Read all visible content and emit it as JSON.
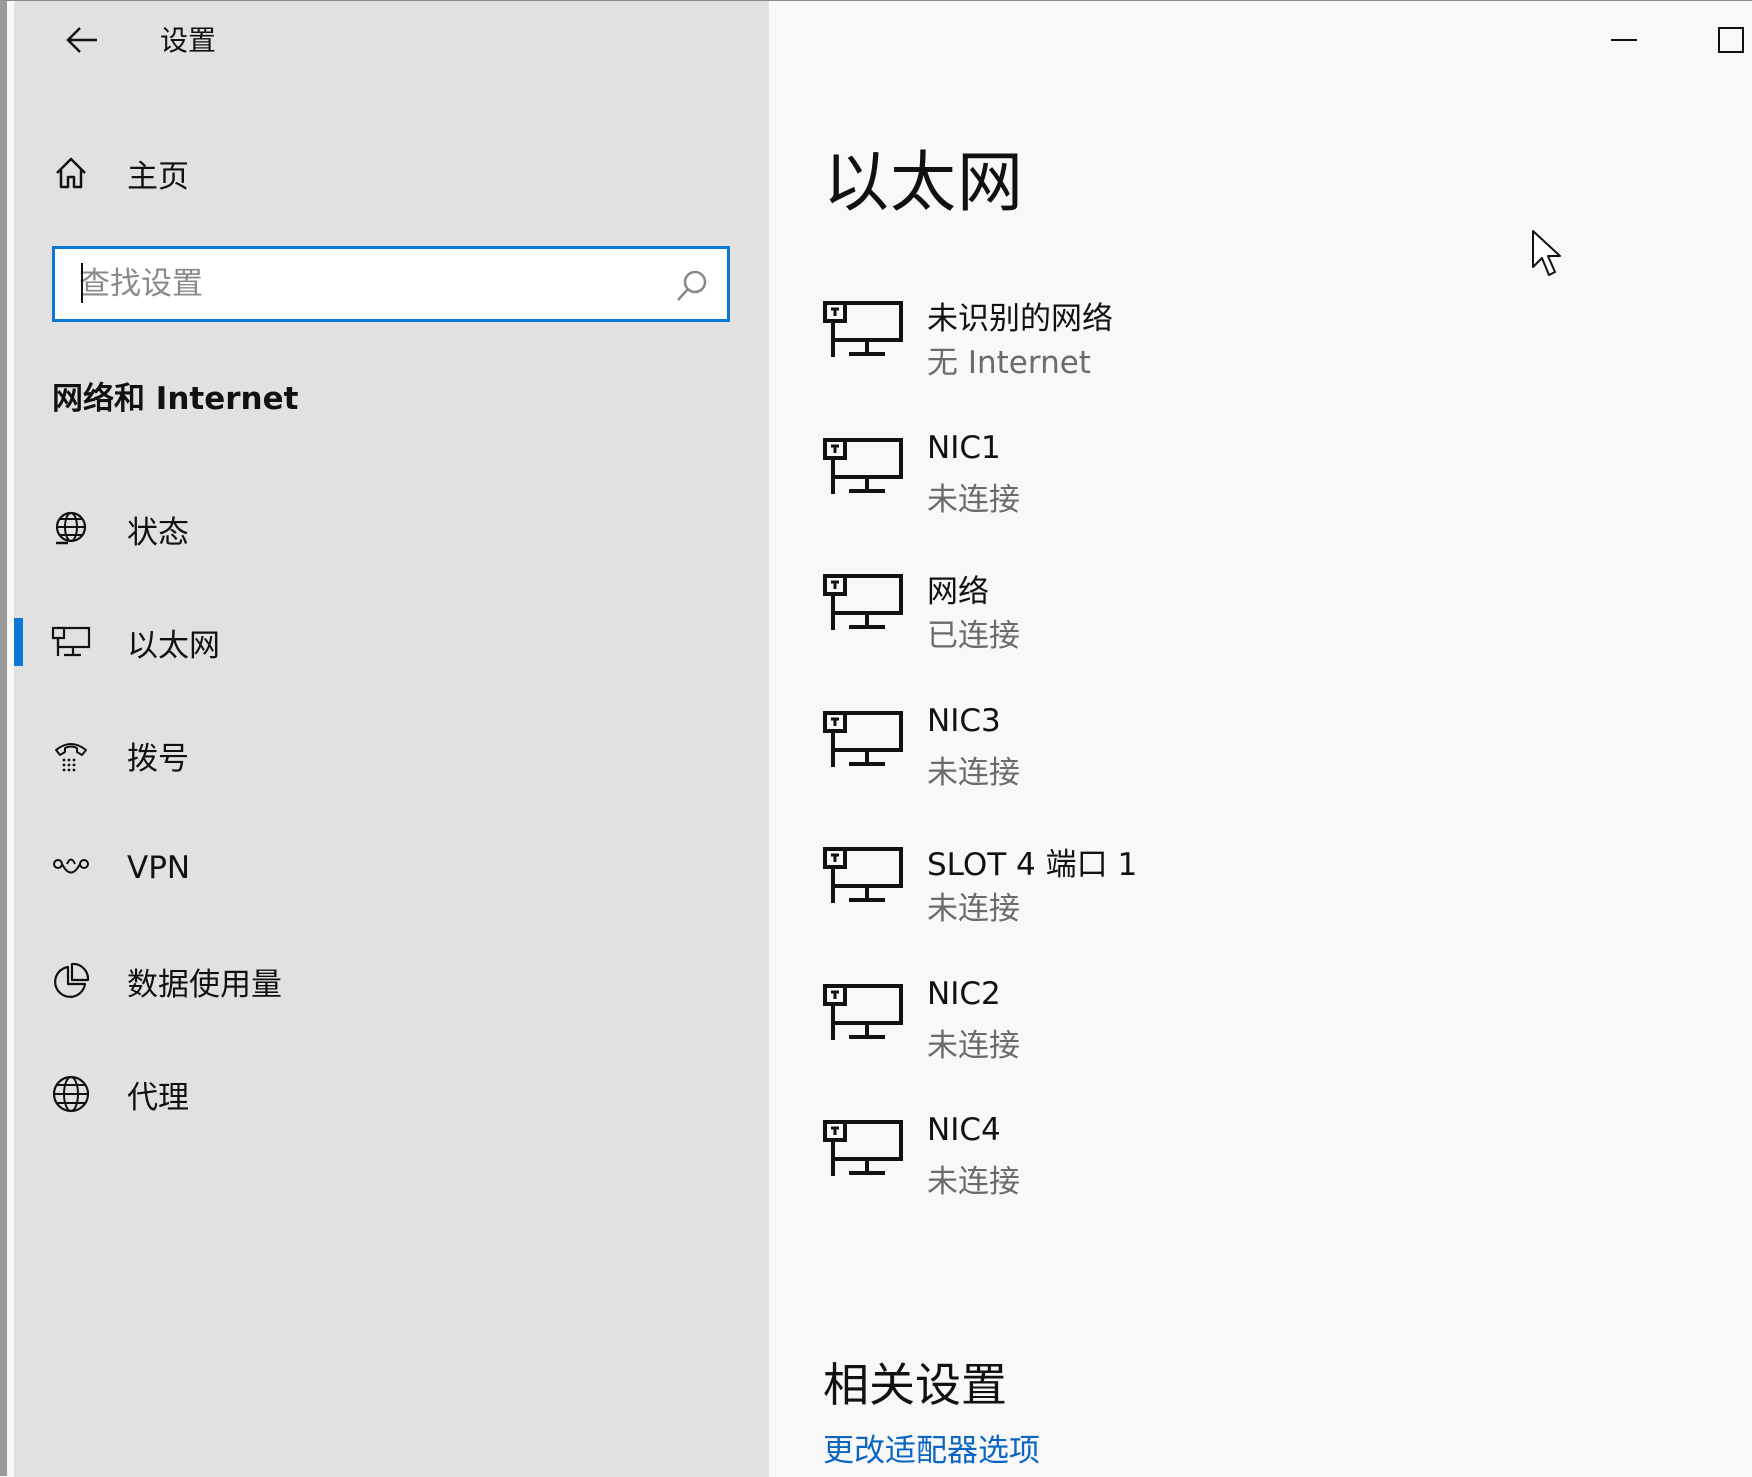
{
  "app": {
    "title": "设置"
  },
  "sidebar": {
    "home_label": "主页",
    "search_placeholder": "查找设置",
    "section_title": "网络和 Internet",
    "items": [
      {
        "label": "状态",
        "icon": "globe-status-icon",
        "selected": false
      },
      {
        "label": "以太网",
        "icon": "ethernet-icon",
        "selected": true
      },
      {
        "label": "拨号",
        "icon": "dialup-icon",
        "selected": false
      },
      {
        "label": "VPN",
        "icon": "vpn-icon",
        "selected": false
      },
      {
        "label": "数据使用量",
        "icon": "data-usage-icon",
        "selected": false
      },
      {
        "label": "代理",
        "icon": "globe-icon",
        "selected": false
      }
    ]
  },
  "main": {
    "title": "以太网",
    "networks": [
      {
        "name": "未识别的网络",
        "status": "无 Internet"
      },
      {
        "name": "NIC1",
        "status": "未连接"
      },
      {
        "name": "网络",
        "status": "已连接"
      },
      {
        "name": "NIC3",
        "status": "未连接"
      },
      {
        "name": "SLOT 4 端口 1",
        "status": "未连接"
      },
      {
        "name": "NIC2",
        "status": "未连接"
      },
      {
        "name": "NIC4",
        "status": "未连接"
      }
    ],
    "related_title": "相关设置",
    "related_link": "更改适配器选项"
  },
  "colors": {
    "accent": "#0a78d7",
    "link": "#0a66c2",
    "sidebar_bg": "#e1e1e1",
    "main_bg": "#f8f8f8",
    "secondary_text": "#6b6b6b"
  }
}
